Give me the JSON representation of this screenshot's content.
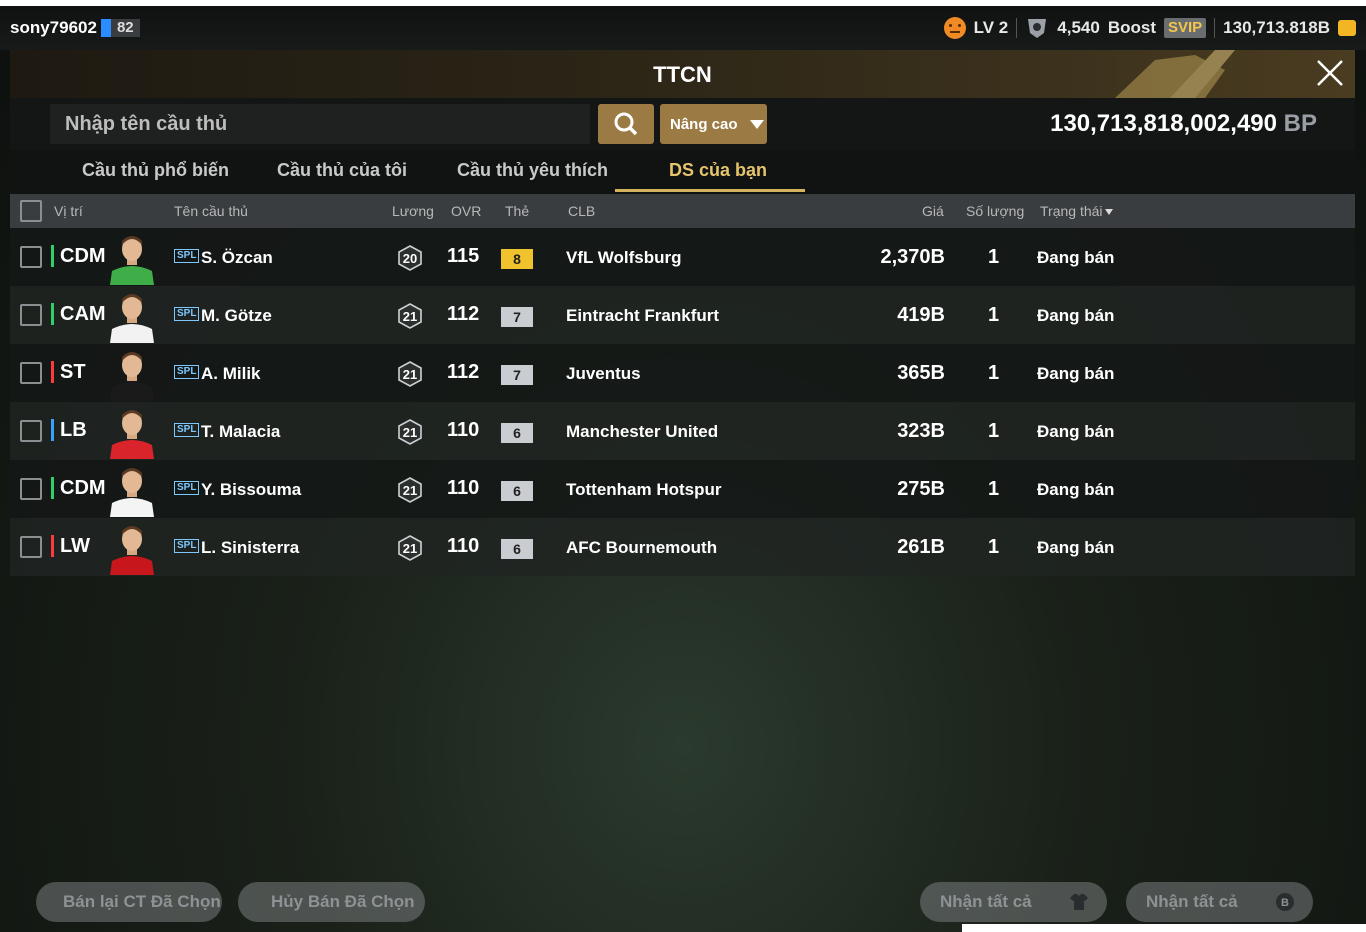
{
  "topbar": {
    "username": "sony79602",
    "level_badge": "82",
    "lv": "LV 2",
    "points": "4,540",
    "boost": "Boost",
    "svip": "SVIP",
    "balance": "130,713.818B"
  },
  "window": {
    "title": "TTCN"
  },
  "search": {
    "placeholder": "Nhập tên cầu thủ",
    "advanced_label": "Nâng cao",
    "bp_value": "130,713,818,002,490",
    "bp_unit": "BP"
  },
  "tabs": [
    {
      "label": "Cầu thủ phổ biến"
    },
    {
      "label": "Cầu thủ của tôi"
    },
    {
      "label": "Cầu thủ yêu thích"
    },
    {
      "label": "DS của bạn",
      "active": true
    }
  ],
  "columns": {
    "position": "Vị trí",
    "name": "Tên cầu thủ",
    "salary": "Lương",
    "ovr": "OVR",
    "card": "Thẻ",
    "club": "CLB",
    "price": "Giá",
    "quantity": "Số lượng",
    "status": "Trạng thái"
  },
  "rows": [
    {
      "pos": "CDM",
      "pos_color": "#2fd06a",
      "season": "SPL",
      "name": "S. Özcan",
      "salary": "20",
      "ovr": "115",
      "card": "8",
      "card_tier": "gold",
      "club": "VfL Wolfsburg",
      "price": "2,370B",
      "qty": "1",
      "status": "Đang bán",
      "kit": "#3fae49"
    },
    {
      "pos": "CAM",
      "pos_color": "#2fd06a",
      "season": "SPL",
      "name": "M. Götze",
      "salary": "21",
      "ovr": "112",
      "card": "7",
      "card_tier": "silver",
      "club": "Eintracht Frankfurt",
      "price": "419B",
      "qty": "1",
      "status": "Đang bán",
      "kit": "#f2f2f2"
    },
    {
      "pos": "ST",
      "pos_color": "#ff3a3a",
      "season": "SPL",
      "name": "A. Milik",
      "salary": "21",
      "ovr": "112",
      "card": "7",
      "card_tier": "silver",
      "club": "Juventus",
      "price": "365B",
      "qty": "1",
      "status": "Đang bán",
      "kit": "#1a1a1a"
    },
    {
      "pos": "LB",
      "pos_color": "#3aa0ff",
      "season": "SPL",
      "name": "T. Malacia",
      "salary": "21",
      "ovr": "110",
      "card": "6",
      "card_tier": "silver",
      "club": "Manchester United",
      "price": "323B",
      "qty": "1",
      "status": "Đang bán",
      "kit": "#d8242a"
    },
    {
      "pos": "CDM",
      "pos_color": "#2fd06a",
      "season": "SPL",
      "name": "Y. Bissouma",
      "salary": "21",
      "ovr": "110",
      "card": "6",
      "card_tier": "silver",
      "club": "Tottenham Hotspur",
      "price": "275B",
      "qty": "1",
      "status": "Đang bán",
      "kit": "#f4f4f4"
    },
    {
      "pos": "LW",
      "pos_color": "#ff3a3a",
      "season": "SPL",
      "name": "L. Sinisterra",
      "salary": "21",
      "ovr": "110",
      "card": "6",
      "card_tier": "silver",
      "club": "AFC Bournemouth",
      "price": "261B",
      "qty": "1",
      "status": "Đang bán",
      "kit": "#c8161d"
    }
  ],
  "footer": {
    "resell_selected": "Bán lại CT Đã Chọn",
    "cancel_selected": "Hủy Bán Đã Chọn",
    "receive_all_1": "Nhận tất cả",
    "receive_all_2": "Nhận tất cả"
  }
}
